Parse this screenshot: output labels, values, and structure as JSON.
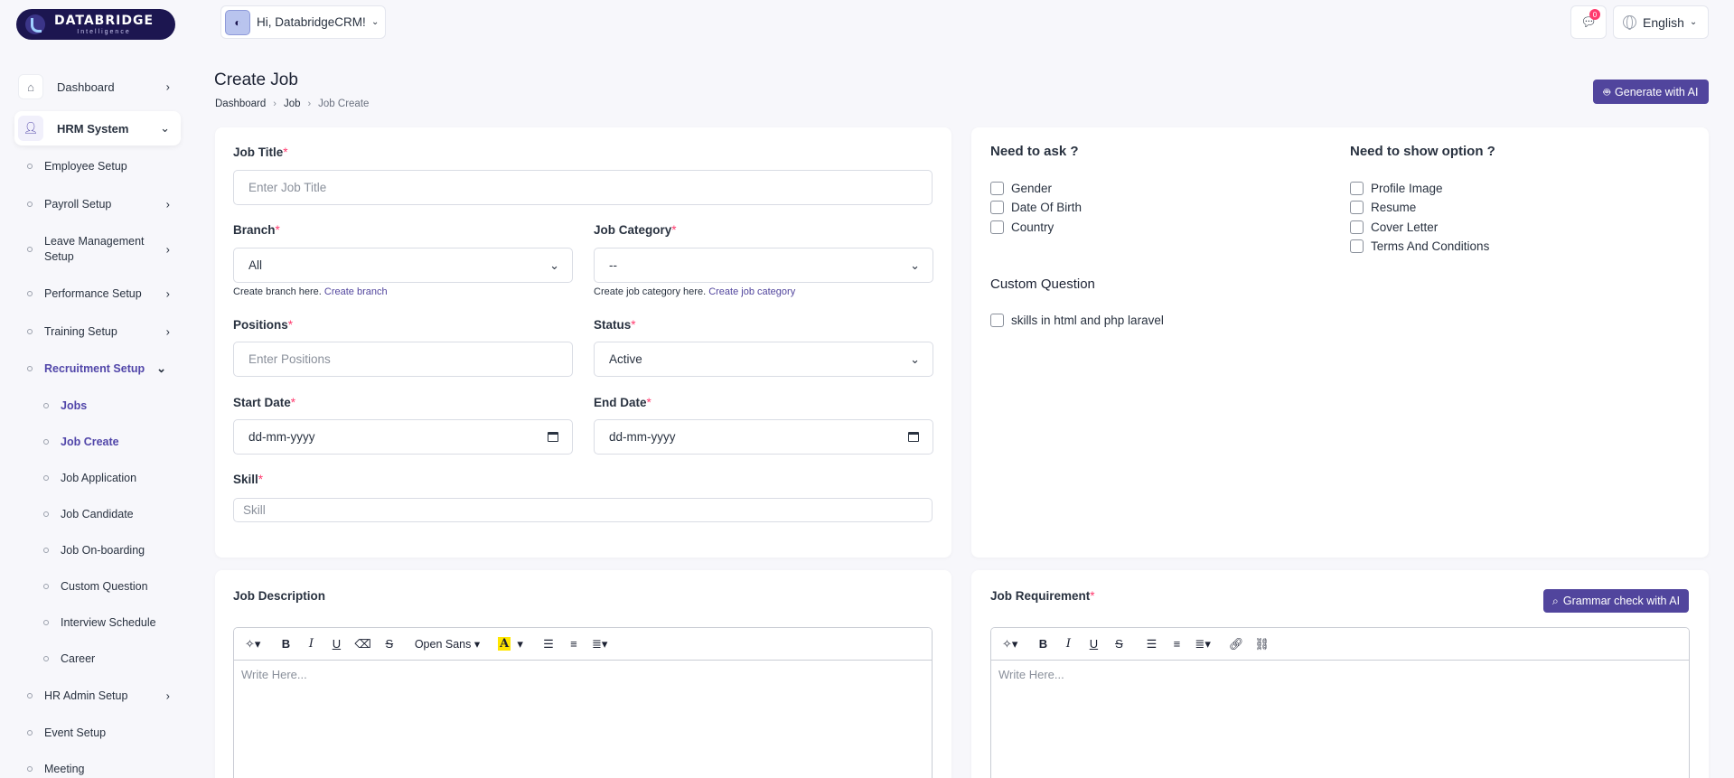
{
  "brand": {
    "name": "DATABRIDGE",
    "tagline": "Intelligence"
  },
  "topbar": {
    "greeting": "Hi, DatabridgeCRM!",
    "notif_count": "0",
    "language": "English"
  },
  "sidebar": {
    "dashboard": "Dashboard",
    "hrm": "HRM System",
    "items": [
      {
        "label": "Employee Setup"
      },
      {
        "label": "Payroll Setup"
      },
      {
        "label": "Leave Management Setup"
      },
      {
        "label": "Performance Setup"
      },
      {
        "label": "Training Setup"
      },
      {
        "label": "Recruitment Setup"
      },
      {
        "label": "HR Admin Setup"
      },
      {
        "label": "Event Setup"
      },
      {
        "label": "Meeting"
      }
    ],
    "recruitment_items": [
      {
        "label": "Jobs"
      },
      {
        "label": "Job Create"
      },
      {
        "label": "Job Application"
      },
      {
        "label": "Job Candidate"
      },
      {
        "label": "Job On-boarding"
      },
      {
        "label": "Custom Question"
      },
      {
        "label": "Interview Schedule"
      },
      {
        "label": "Career"
      }
    ]
  },
  "header": {
    "title": "Create Job",
    "breadcrumb": [
      "Dashboard",
      "Job",
      "Job Create"
    ],
    "ai_button": "Generate with AI"
  },
  "form": {
    "job_title": {
      "label": "Job Title",
      "placeholder": "Enter Job Title"
    },
    "branch": {
      "label": "Branch",
      "value": "All",
      "help": "Create branch here.",
      "link": "Create branch"
    },
    "category": {
      "label": "Job Category",
      "value": "--",
      "help": "Create job category here.",
      "link": "Create job category"
    },
    "positions": {
      "label": "Positions",
      "placeholder": "Enter Positions"
    },
    "status": {
      "label": "Status",
      "value": "Active"
    },
    "start_date": {
      "label": "Start Date",
      "placeholder": "dd-mm-yyyy"
    },
    "end_date": {
      "label": "End Date",
      "placeholder": "dd-mm-yyyy"
    },
    "skill": {
      "label": "Skill",
      "placeholder": "Skill"
    },
    "required_mark": "*"
  },
  "options": {
    "ask_title": "Need to ask ?",
    "ask": [
      "Gender",
      "Date Of Birth",
      "Country"
    ],
    "show_title": "Need to show option ?",
    "show": [
      "Profile Image",
      "Resume",
      "Cover Letter",
      "Terms And Conditions"
    ],
    "custom_title": "Custom Question",
    "custom": [
      "skills in html and php laravel"
    ]
  },
  "description": {
    "title": "Job Description",
    "font": "Open Sans",
    "placeholder": "Write Here..."
  },
  "requirement": {
    "title": "Job Requirement",
    "grammar_button": "Grammar check with AI",
    "placeholder": "Write Here..."
  },
  "colors": {
    "accent": "#51459d",
    "required": "#ff3a6e"
  }
}
